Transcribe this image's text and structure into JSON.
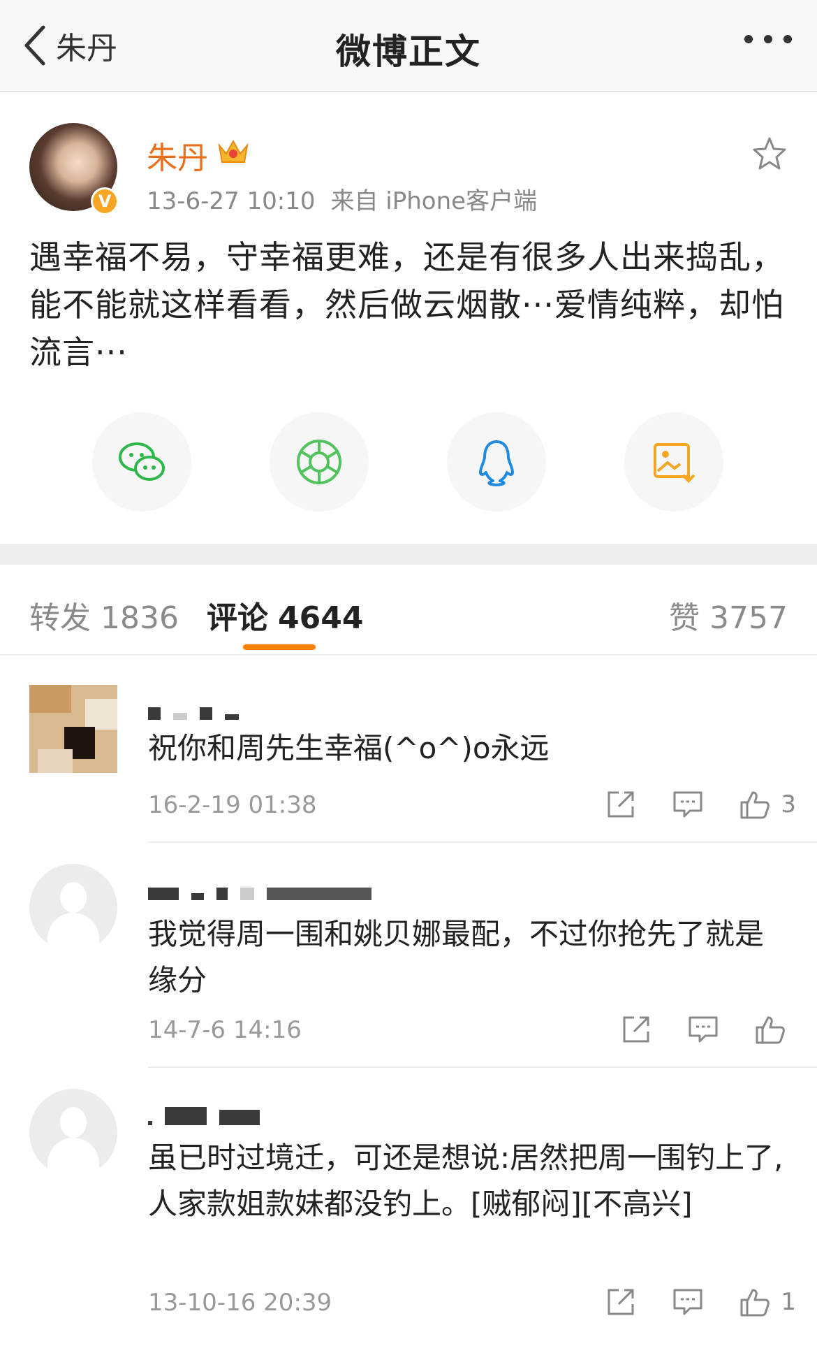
{
  "header": {
    "back_label": "朱丹",
    "title": "微博正文"
  },
  "post": {
    "author": "朱丹",
    "time": "13-6-27 10:10",
    "source": "来自 iPhone客户端",
    "text": "遇幸福不易，守幸福更难，还是有很多人出来捣乱，能不能就这样看看，然后做云烟散···爱情纯粹，却怕流言···",
    "verified_badge": "V"
  },
  "share": [
    {
      "icon": "wechat-icon"
    },
    {
      "icon": "moments-icon"
    },
    {
      "icon": "qq-icon"
    },
    {
      "icon": "save-image-icon"
    }
  ],
  "tabs": {
    "repost_label": "转发",
    "repost_count": "1836",
    "comment_label": "评论",
    "comment_count": "4644",
    "like_label": "赞",
    "like_count": "3757",
    "accent": "#ff8200"
  },
  "comments": [
    {
      "text": "祝你和周先生幸福(^o^)o永远",
      "time": "16-2-19 01:38",
      "likes": "3"
    },
    {
      "text": "我觉得周一围和姚贝娜最配，不过你抢先了就是缘分",
      "time": "14-7-6 14:16",
      "likes": ""
    },
    {
      "text": "虽已时过境迁，可还是想说:居然把周一围钓上了,人家款姐款妹都没钓上。[贼郁闷][不高兴]",
      "time": "13-10-16 20:39",
      "likes": "1"
    }
  ],
  "colors": {
    "name_orange": "#ea6f1c",
    "wechat_green": "#2fb84a",
    "moments_green": "#52c35d",
    "qq_blue": "#1e8be0",
    "save_orange": "#f5a623"
  }
}
